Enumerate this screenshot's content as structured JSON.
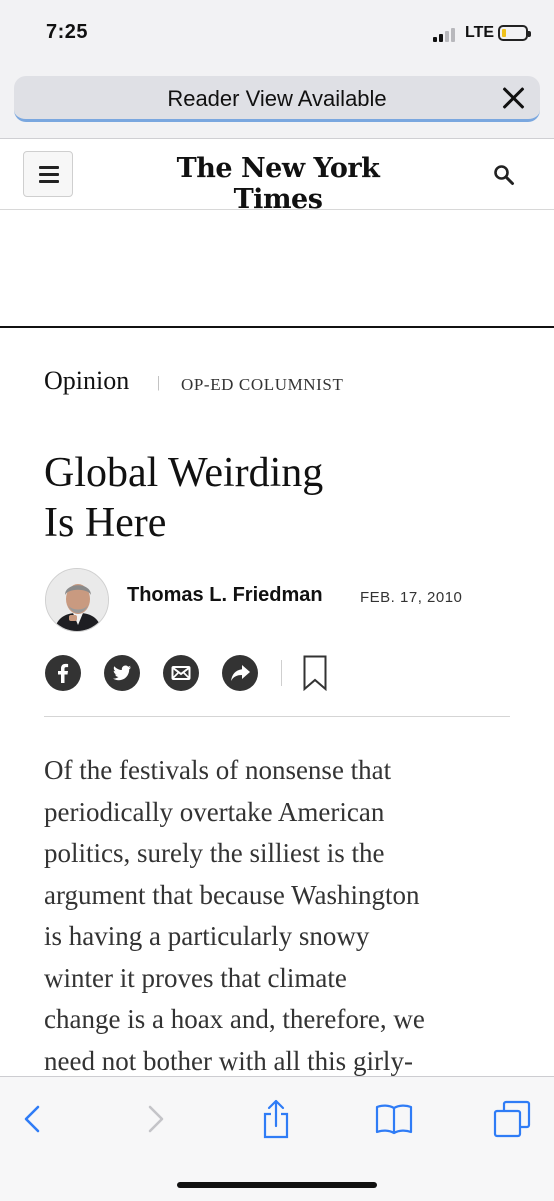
{
  "status_bar": {
    "time": "7:25",
    "network": "LTE",
    "signal_bars_active": 2,
    "battery_level": 0.2
  },
  "browser": {
    "reader_view_label": "Reader View Available"
  },
  "site": {
    "masthead": "The New York Times"
  },
  "article": {
    "section": "Opinion",
    "separator": "|",
    "column": "OP-ED COLUMNIST",
    "headline_lines": [
      "Global Weirding",
      "Is Here"
    ],
    "author": "Thomas L. Friedman",
    "date": "FEB. 17, 2010",
    "body_lines": [
      "Of the festivals of nonsense that",
      "periodically overtake American",
      "politics, surely the silliest is the",
      "argument that because Washington",
      "is having a particularly snowy",
      "winter it proves that climate",
      "change is a hoax and, therefore, we",
      "need not bother with all this girly-"
    ]
  },
  "share_buttons": [
    "facebook-icon",
    "twitter-icon",
    "email-icon",
    "share-icon",
    "bookmark-icon"
  ],
  "toolbar_icons": [
    "back-icon",
    "forward-icon",
    "share-icon",
    "bookmarks-icon",
    "tabs-icon"
  ],
  "colors": {
    "ios_blue": "#2f7cf6",
    "share_circle": "#333333",
    "reader_underline": "#7aa7df"
  }
}
